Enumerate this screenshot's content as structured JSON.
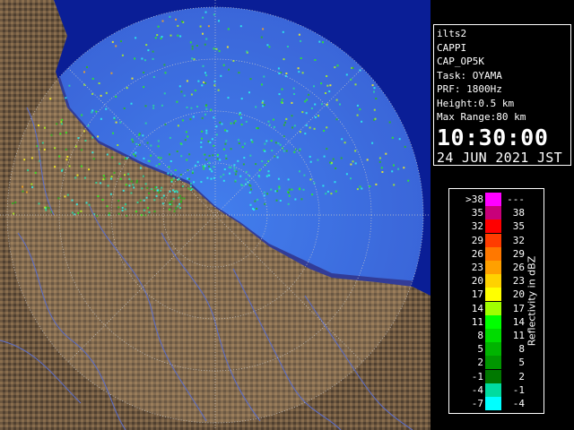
{
  "info": {
    "radar": "ilts2",
    "product": "CAPPI",
    "product_code": "CAP_OP5K",
    "task": "Task: OYAMA",
    "prf": "PRF: 1800Hz",
    "height": "Height:0.5 km",
    "max_range": "Max Range:80 km",
    "time": "10:30:00",
    "date": "24 JUN 2021 JST"
  },
  "legend": {
    "unit_label": "Reflectivity in dBZ",
    "rows": [
      {
        "lo": ">38",
        "hi": "---",
        "color": "#ff00ff"
      },
      {
        "lo": "35",
        "hi": "38",
        "color": "#c8007a"
      },
      {
        "lo": "32",
        "hi": "35",
        "color": "#ff0000"
      },
      {
        "lo": "29",
        "hi": "32",
        "color": "#ff3c00"
      },
      {
        "lo": "26",
        "hi": "29",
        "color": "#ff7800"
      },
      {
        "lo": "23",
        "hi": "26",
        "color": "#ffa000"
      },
      {
        "lo": "20",
        "hi": "23",
        "color": "#ffd200"
      },
      {
        "lo": "17",
        "hi": "20",
        "color": "#ffff00"
      },
      {
        "lo": "14",
        "hi": "17",
        "color": "#a0ff00"
      },
      {
        "lo": "11",
        "hi": "14",
        "color": "#00ff00"
      },
      {
        "lo": "8",
        "hi": "11",
        "color": "#00dc00"
      },
      {
        "lo": "5",
        "hi": "8",
        "color": "#00b400"
      },
      {
        "lo": "2",
        "hi": "5",
        "color": "#009600"
      },
      {
        "lo": "-1",
        "hi": "2",
        "color": "#007800"
      },
      {
        "lo": "-4",
        "hi": "-1",
        "color": "#00dca0"
      },
      {
        "lo": "-7",
        "hi": "-4",
        "color": "#00ffff"
      }
    ]
  },
  "colors": {
    "sea": "#0a1e96",
    "echo_sea": "#1e5aff",
    "terrain_dark": "#5a4632",
    "terrain_light": "#8c7050",
    "range_ring": "#c8c8c8",
    "river": "#5a6ecc"
  }
}
